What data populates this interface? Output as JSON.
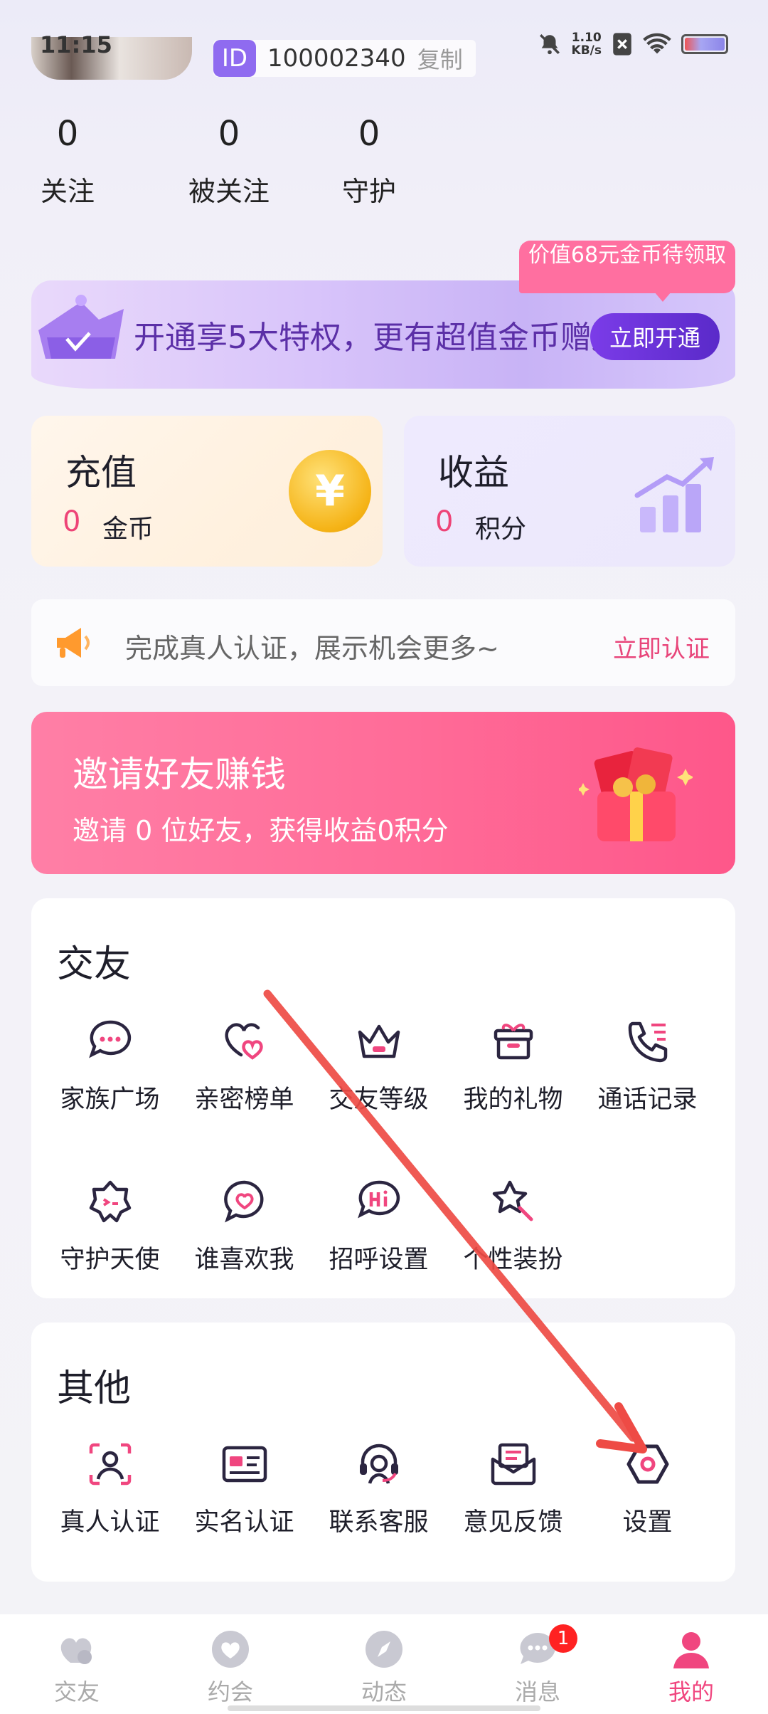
{
  "status": {
    "time": "11:15",
    "speed_value": "1.10",
    "speed_unit": "KB/s"
  },
  "profile": {
    "id_tag": "ID",
    "id_number": "100002340",
    "copy_label": "复制"
  },
  "stats": [
    {
      "count": "0",
      "label": "关注"
    },
    {
      "count": "0",
      "label": "被关注"
    },
    {
      "count": "0",
      "label": "守护"
    }
  ],
  "vip": {
    "promo_tag": "价值68元金币待领取",
    "text": "开通享5大特权，更有超值金币赠送",
    "button": "立即开通"
  },
  "recharge": {
    "title": "充值",
    "value": "0",
    "unit": "金币",
    "coin_symbol": "¥"
  },
  "income": {
    "title": "收益",
    "value": "0",
    "unit": "积分"
  },
  "notice": {
    "text": "完成真人认证，展示机会更多~",
    "link": "立即认证"
  },
  "invite": {
    "title": "邀请好友赚钱",
    "subtitle": "邀请 0 位好友，获得收益0积分"
  },
  "friends_section": {
    "title": "交友",
    "items": [
      {
        "label": "家族广场",
        "icon": "chat-bubble-icon"
      },
      {
        "label": "亲密榜单",
        "icon": "hearts-icon"
      },
      {
        "label": "交友等级",
        "icon": "crown-icon"
      },
      {
        "label": "我的礼物",
        "icon": "gift-box-icon"
      },
      {
        "label": "通话记录",
        "icon": "phone-log-icon"
      },
      {
        "label": "守护天使",
        "icon": "angel-icon"
      },
      {
        "label": "谁喜欢我",
        "icon": "heart-bubble-icon"
      },
      {
        "label": "招呼设置",
        "icon": "hi-bubble-icon"
      },
      {
        "label": "个性装扮",
        "icon": "star-wand-icon"
      }
    ]
  },
  "other_section": {
    "title": "其他",
    "items": [
      {
        "label": "真人认证",
        "icon": "face-scan-icon"
      },
      {
        "label": "实名认证",
        "icon": "id-card-icon"
      },
      {
        "label": "联系客服",
        "icon": "headset-icon"
      },
      {
        "label": "意见反馈",
        "icon": "mail-icon"
      },
      {
        "label": "设置",
        "icon": "settings-hexagon-icon"
      }
    ]
  },
  "tabbar": {
    "tabs": [
      {
        "label": "交友",
        "icon": "friends-tab-icon"
      },
      {
        "label": "约会",
        "icon": "date-tab-icon"
      },
      {
        "label": "动态",
        "icon": "moments-tab-icon"
      },
      {
        "label": "消息",
        "icon": "message-tab-icon",
        "badge": "1"
      },
      {
        "label": "我的",
        "icon": "profile-tab-icon",
        "active": true
      }
    ]
  },
  "colors": {
    "accent": "#f0467f",
    "vip_purple": "#5b2fa7",
    "icon_dark": "#2b2540",
    "arrow_red": "#ee4b45"
  }
}
